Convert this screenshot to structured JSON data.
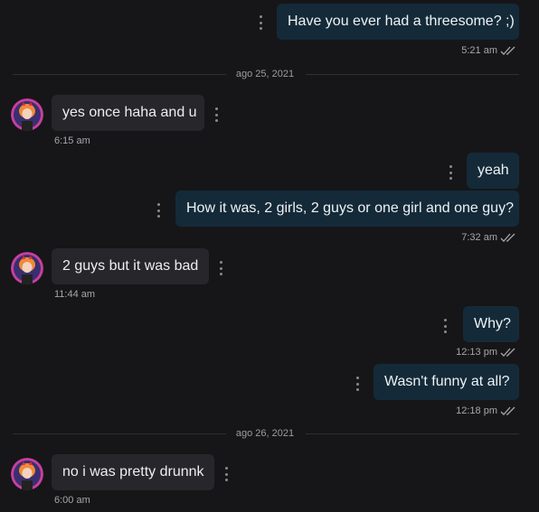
{
  "dates": [
    "ago 25, 2021",
    "ago 26, 2021"
  ],
  "messages": [
    {
      "dir": "out",
      "text": "Have you ever had a threesome? ;)",
      "time": "5:21 am"
    },
    {
      "dir": "in",
      "text": "yes once haha and u",
      "time": "6:15 am"
    },
    {
      "dir": "out",
      "text": "yeah",
      "time": ""
    },
    {
      "dir": "out",
      "text": "How it was, 2 girls, 2 guys or one girl and one guy?",
      "time": "7:32 am"
    },
    {
      "dir": "in",
      "text": "2 guys but it was bad",
      "time": "11:44 am"
    },
    {
      "dir": "out",
      "text": "Why?",
      "time": "12:13 pm"
    },
    {
      "dir": "out",
      "text": "Wasn't funny at all?",
      "time": "12:18 pm"
    },
    {
      "dir": "in",
      "text": "no i was pretty drunnk",
      "time": "6:00 am"
    }
  ],
  "colors": {
    "background": "#161618",
    "outgoing_bubble": "#142a38",
    "incoming_bubble": "#27272b",
    "avatar_ring": "#c83fa0"
  },
  "icons": {
    "message_menu": "kebab-vertical-icon",
    "read_receipt": "double-check-icon",
    "avatar": "contact-avatar"
  }
}
